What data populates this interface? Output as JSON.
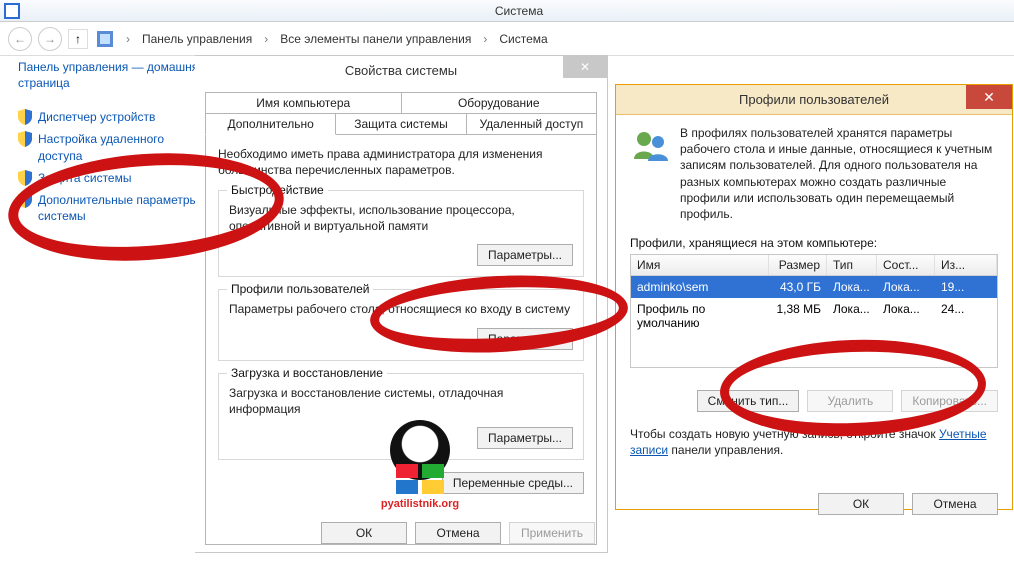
{
  "window": {
    "title": "Система"
  },
  "breadcrumbs": {
    "items": [
      "Панель управления",
      "Все элементы панели управления",
      "Система"
    ]
  },
  "leftpanel": {
    "home": "Панель управления — домашняя страница",
    "links": [
      "Диспетчер устройств",
      "Настройка удаленного доступа",
      "Защита системы",
      "Дополнительные параметры системы"
    ]
  },
  "sysprop": {
    "title": "Свойства системы",
    "tabs_top": [
      "Имя компьютера",
      "Оборудование"
    ],
    "tabs_bottom": [
      "Дополнительно",
      "Защита системы",
      "Удаленный доступ"
    ],
    "active_tab": "Дополнительно",
    "intro": "Необходимо иметь права администратора для изменения большинства перечисленных параметров.",
    "groups": {
      "perf": {
        "legend": "Быстродействие",
        "desc": "Визуальные эффекты, использование процессора, оперативной и виртуальной памяти",
        "btn": "Параметры..."
      },
      "profiles": {
        "legend": "Профили пользователей",
        "desc": "Параметры рабочего стола, относящиеся ко входу в систему",
        "btn": "Параметры..."
      },
      "startup": {
        "legend": "Загрузка и восстановление",
        "desc": "Загрузка и восстановление системы, отладочная информация",
        "btn": "Параметры..."
      }
    },
    "envbtn": "Переменные среды...",
    "footer": {
      "ok": "ОК",
      "cancel": "Отмена",
      "apply": "Применить"
    }
  },
  "profdlg": {
    "title": "Профили пользователей",
    "intro": "В профилях пользователей хранятся параметры рабочего стола и иные данные, относящиеся к учетным записям пользователей. Для одного пользователя на разных компьютерах можно создать различные профили или использовать один перемещаемый профиль.",
    "list_label": "Профили, хранящиеся на этом компьютере:",
    "columns": {
      "name": "Имя",
      "size": "Размер",
      "type": "Тип",
      "status": "Сост...",
      "changed": "Из..."
    },
    "rows": [
      {
        "name": "adminko\\sem",
        "size": "43,0 ГБ",
        "type": "Лока...",
        "status": "Лока...",
        "changed": "19..."
      },
      {
        "name": "Профиль по умолчанию",
        "size": "1,38 МБ",
        "type": "Лока...",
        "status": "Лока...",
        "changed": "24..."
      }
    ],
    "buttons": {
      "change": "Сменить тип...",
      "delete": "Удалить",
      "copy": "Копировать..."
    },
    "hint_prefix": "Чтобы создать новую учетную запись, откройте значок ",
    "hint_link": "Учетные записи",
    "hint_suffix": " панели управления.",
    "footer": {
      "ok": "ОК",
      "cancel": "Отмена"
    }
  },
  "watermark": "pyatilistnik.org"
}
